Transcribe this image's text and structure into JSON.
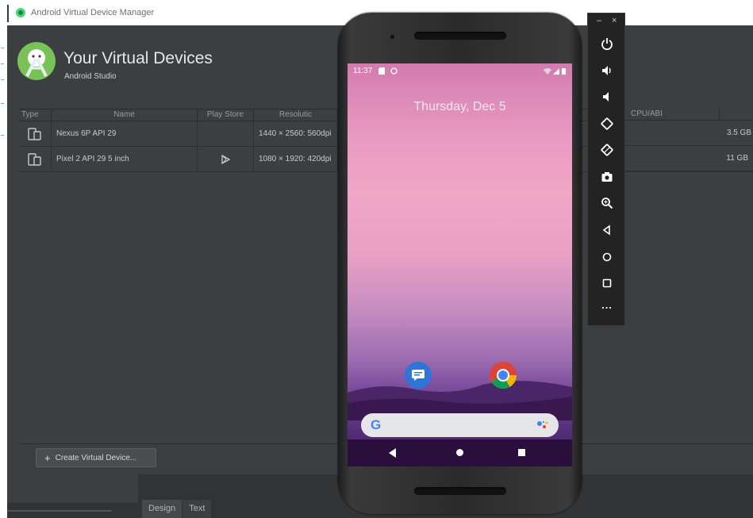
{
  "window": {
    "title": "Android Virtual Device Manager"
  },
  "header": {
    "title": "Your Virtual Devices",
    "subtitle": "Android Studio"
  },
  "table": {
    "columns": [
      "Type",
      "Name",
      "Play Store",
      "Resolutic",
      "CPU/ABI"
    ],
    "rows": [
      {
        "name": "Nexus 6P API 29",
        "resolution": "1440 × 2560: 560dpi",
        "size": "3.5 GB",
        "play_store": false
      },
      {
        "name": "Pixel 2 API 29 5 inch",
        "resolution": "1080 × 1920: 420dpi",
        "size": "11 GB",
        "play_store": true
      }
    ]
  },
  "footer": {
    "create_button_label": "Create Virtual Device..."
  },
  "bottom_tabs": [
    "Design",
    "Text"
  ],
  "emulator": {
    "status_time": "11:37",
    "date": "Thursday, Dec 5",
    "search_logo": "G",
    "toolbar_icons": [
      "power-icon",
      "volume-up-icon",
      "volume-down-icon",
      "rotate-left-icon",
      "rotate-right-icon",
      "camera-icon",
      "zoom-icon",
      "back-icon",
      "home-icon",
      "overview-icon",
      "more-icon"
    ],
    "toolbar_more": "..."
  }
}
